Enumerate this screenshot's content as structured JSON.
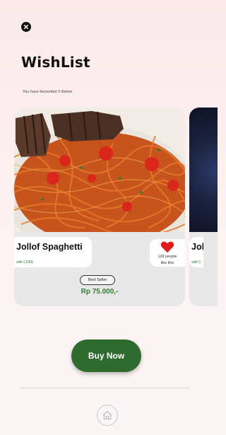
{
  "header": {
    "title": "WishList",
    "subtitle": "You have favourited 3 dishes"
  },
  "icons": {
    "close": "close-icon",
    "heart": "heart-icon",
    "home": "home-icon"
  },
  "cards": [
    {
      "name": "Jollof Spaghetti",
      "sub": "with COKE",
      "likes": "128 people",
      "likes_suffix": "like this",
      "badge": "Best Seller",
      "price": "Rp 75.000,-"
    },
    {
      "name": "Jol",
      "sub": "with C"
    }
  ],
  "actions": {
    "buy_now": "Buy Now"
  },
  "colors": {
    "accent_green": "#2f6b2f",
    "price_green": "#2e7d32",
    "heart_red": "#e01b1b"
  }
}
